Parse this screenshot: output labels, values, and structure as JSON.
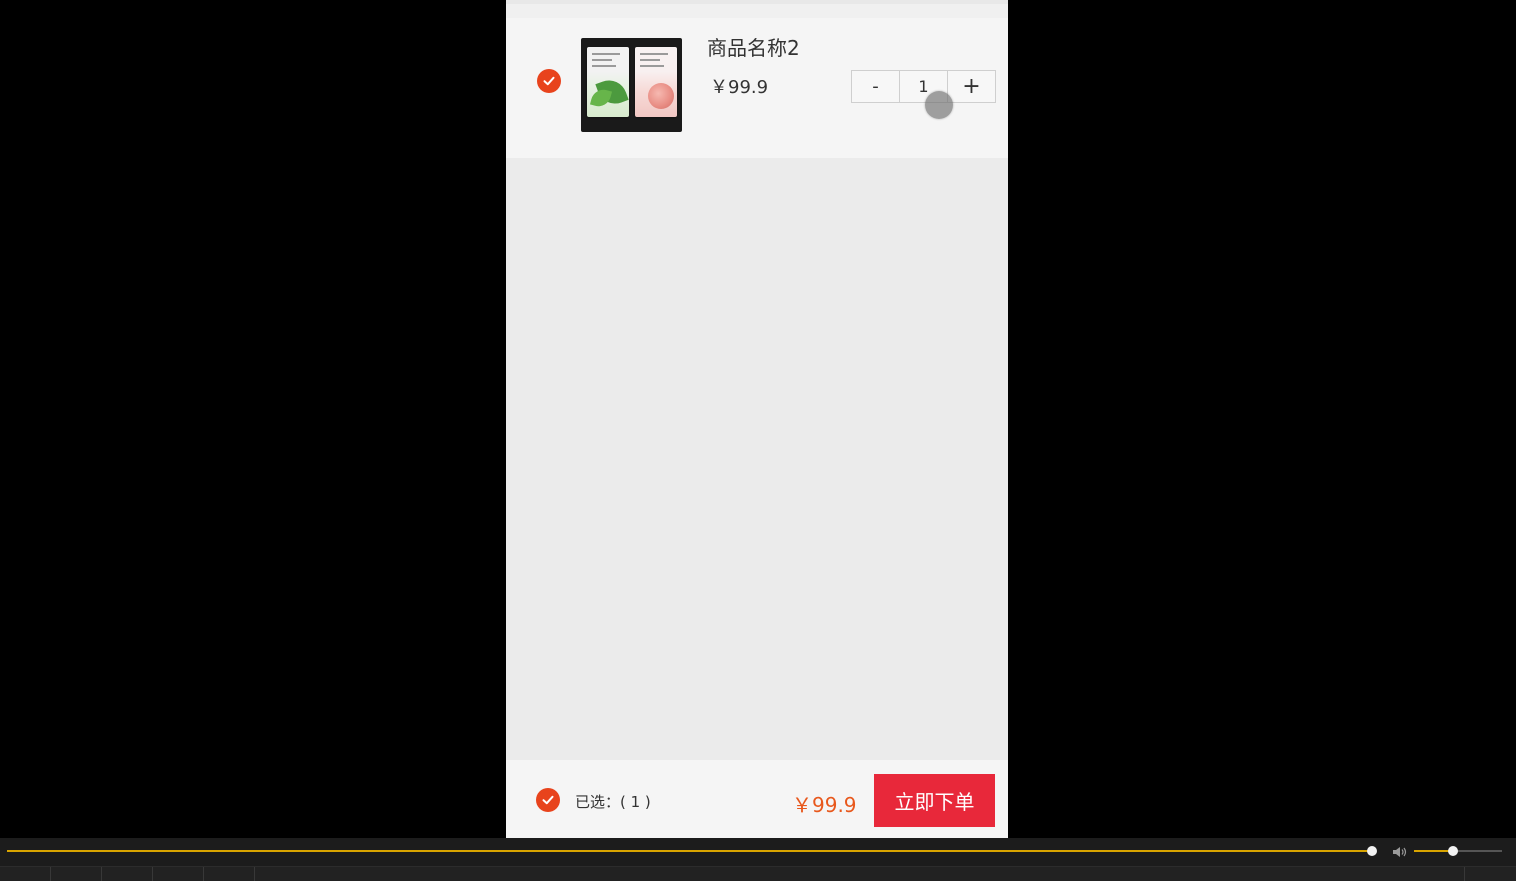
{
  "cart": {
    "item": {
      "name": "商品名称2",
      "price": "￥99.9",
      "quantity": "1",
      "minus_label": "-",
      "plus_label": "+",
      "checked": true
    },
    "footer": {
      "selected_text": "已选：( 1 )",
      "total": "￥99.9",
      "order_button": "立即下单",
      "all_checked": true
    }
  },
  "player": {
    "progress": 0.995,
    "volume": 0.45,
    "colors": {
      "accent": "#d8a400",
      "track": "#555555"
    }
  },
  "colors": {
    "check_red": "#e8431c",
    "order_button": "#e8283a",
    "total_text": "#e8581c"
  }
}
